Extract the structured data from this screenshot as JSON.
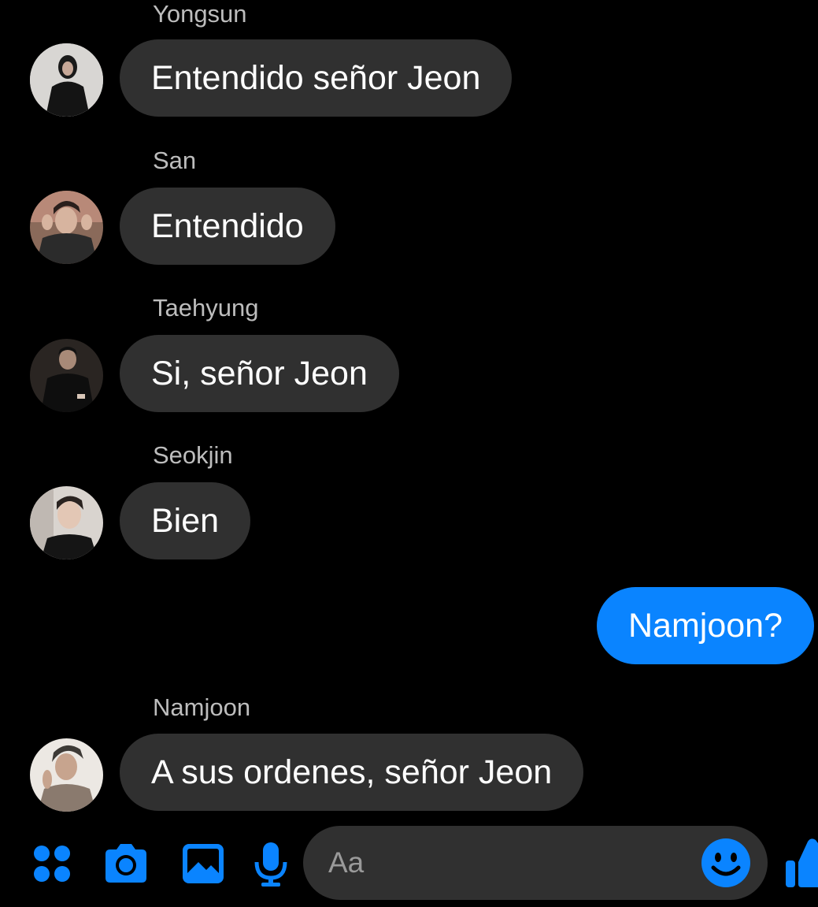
{
  "accent_color": "#0a84ff",
  "incoming_bubble_color": "#303030",
  "messages": [
    {
      "sender": "Yongsun",
      "text": "Entendido señor Jeon",
      "direction": "incoming"
    },
    {
      "sender": "San",
      "text": "Entendido",
      "direction": "incoming"
    },
    {
      "sender": "Taehyung",
      "text": "Si, señor Jeon",
      "direction": "incoming"
    },
    {
      "sender": "Seokjin",
      "text": "Bien",
      "direction": "incoming"
    },
    {
      "sender": "",
      "text": "Namjoon?",
      "direction": "outgoing"
    },
    {
      "sender": "Namjoon",
      "text": "A sus ordenes, señor Jeon",
      "direction": "incoming"
    }
  ],
  "composer": {
    "placeholder": "Aa",
    "icons": [
      "apps-icon",
      "camera-icon",
      "gallery-icon",
      "microphone-icon",
      "emoji-icon",
      "thumbs-up-icon"
    ]
  }
}
